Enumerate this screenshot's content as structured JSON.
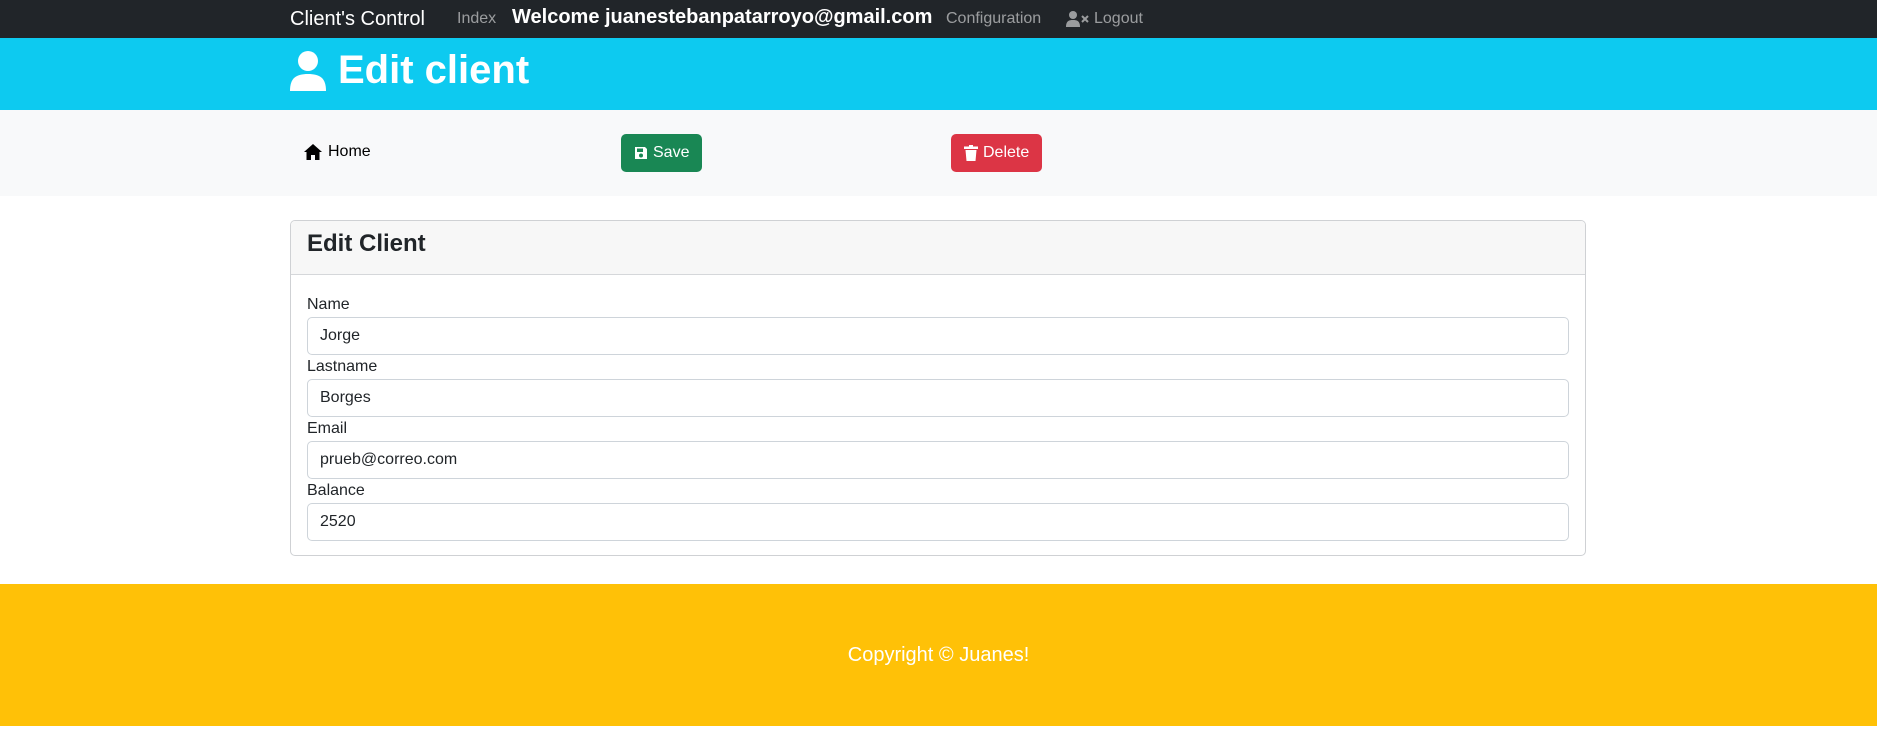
{
  "navbar": {
    "brand": "Client's Control",
    "index_link": "Index",
    "welcome": "Welcome juanestebanpatarroyo@gmail.com",
    "configuration_link": "Configuration",
    "logout_link": "Logout"
  },
  "header": {
    "title": "Edit client",
    "icon": "user-icon"
  },
  "actions": {
    "home_label": "Home",
    "save_label": "Save",
    "delete_label": "Delete"
  },
  "card": {
    "title": "Edit Client",
    "fields": [
      {
        "label": "Name",
        "value": "Jorge"
      },
      {
        "label": "Lastname",
        "value": "Borges"
      },
      {
        "label": "Email",
        "value": "prueb@correo.com"
      },
      {
        "label": "Balance",
        "value": "2520"
      }
    ]
  },
  "footer": {
    "copyright": "Copyright © Juanes!"
  },
  "colors": {
    "navbar": "#212529",
    "header": "#0dcaf0",
    "actions_bar": "#f8f9fa",
    "save": "#198754",
    "delete": "#dc3545",
    "footer": "#ffc107"
  }
}
